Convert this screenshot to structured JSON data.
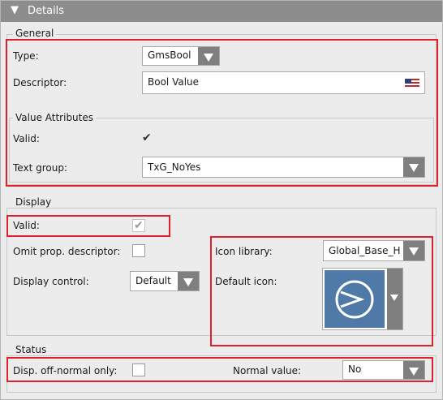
{
  "header": {
    "title": "Details",
    "collapse_icon": "triangle-down-icon"
  },
  "general": {
    "legend": "General",
    "type_label": "Type:",
    "type_value": "GmsBool",
    "descriptor_label": "Descriptor:",
    "descriptor_value": "Bool Value",
    "flag_icon": "us-flag-icon"
  },
  "value_attributes": {
    "legend": "Value Attributes",
    "valid_label": "Valid:",
    "valid_checked": true,
    "text_group_label": "Text group:",
    "text_group_value": "TxG_NoYes"
  },
  "display": {
    "legend": "Display",
    "valid_label": "Valid:",
    "valid_checked": true,
    "omit_label": "Omit prop. descriptor:",
    "omit_checked": false,
    "display_control_label": "Display control:",
    "display_control_value": "Default",
    "icon_library_label": "Icon library:",
    "icon_library_value": "Global_Base_H",
    "default_icon_label": "Default icon:",
    "default_icon_name": "circle-arrow-icon"
  },
  "status": {
    "legend": "Status",
    "off_normal_label": "Disp. off-normal only:",
    "off_normal_checked": false,
    "normal_value_label": "Normal value:",
    "normal_value": "No"
  },
  "colors": {
    "highlight": "#e0202c",
    "header_bg": "#8d8d8d",
    "icon_bg": "#4f7aa8",
    "dropdown_button": "#7f7f7f"
  }
}
